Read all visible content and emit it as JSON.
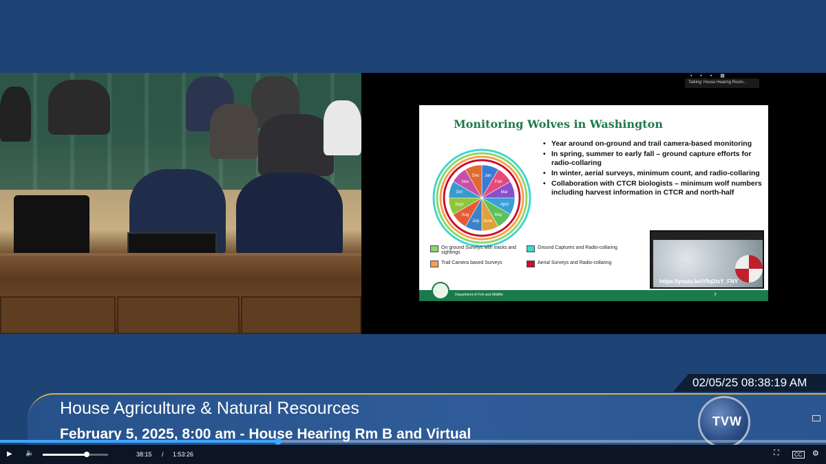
{
  "screen_share": {
    "talking_label": "Talking: House Hearing Room...",
    "toolbar_glyphs": "▪ ▪ ▪ ▦"
  },
  "slide": {
    "title": "Monitoring Wolves in Washington",
    "bullets": [
      "Year around on-ground and trail camera-based monitoring",
      "In spring, summer to early fall – ground capture efforts for radio-collaring",
      "In winter, aerial surveys, minimum count, and radio-collaring",
      "Collaboration with CTCR biologists – minimum wolf numbers including harvest information in CTCR and north-half"
    ],
    "months": [
      "Jan",
      "Feb",
      "Mar",
      "April",
      "May",
      "June",
      "July",
      "Aug",
      "Sept",
      "Oct",
      "Nov",
      "Dec"
    ],
    "legend": [
      {
        "label": "On ground Surveys with tracks and sightings",
        "color": "#8fd66a"
      },
      {
        "label": "Ground Captures and Radio-collaring",
        "color": "#3fd6d0"
      },
      {
        "label": "Trail Camera based Surveys",
        "color": "#f5a04a"
      },
      {
        "label": "Aerial Surveys and Radio-collaring",
        "color": "#c8102e"
      }
    ],
    "video_url": "https://youtu.be/V9q2txY_FNY",
    "footer_org": "Department of Fish and Wildlife",
    "page_number": "7"
  },
  "overlay": {
    "timestamp": "02/05/25 08:38:19 AM",
    "committee": "House Agriculture & Natural Resources",
    "session": "February 5, 2025, 8:00 am - House Hearing Rm B and Virtual",
    "logo_text": "TVW"
  },
  "player": {
    "current_time": "38:15",
    "separator": "/",
    "duration": "1:53:26",
    "progress_fraction": 0.337,
    "volume_fraction": 0.67,
    "play_icon": "▶",
    "volume_icon": "🔈",
    "fullscreen_icon": "⛶",
    "captions_icon": "CC",
    "settings_icon": "⚙"
  }
}
